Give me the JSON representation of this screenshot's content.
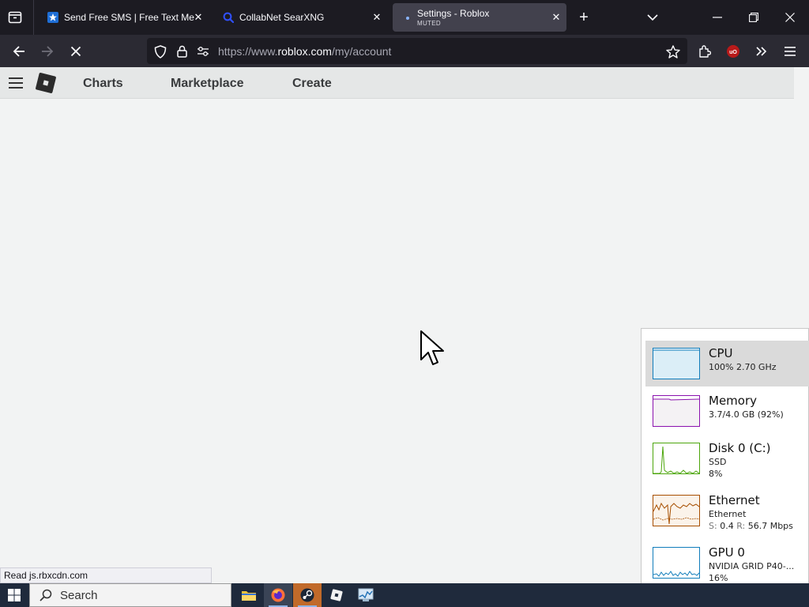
{
  "browser": {
    "tabs": [
      {
        "title": "Send Free SMS | Free Text Messages",
        "active": false,
        "icon": "textfree-favicon"
      },
      {
        "title": "CollabNet SearXNG",
        "active": false,
        "icon": "searxng-favicon"
      },
      {
        "title": "Settings - Roblox",
        "subtitle": "MUTED",
        "active": true,
        "icon": "loading-dot"
      }
    ],
    "url_prefix": "https://www.",
    "url_host": "roblox.com",
    "url_path": "/my/account",
    "status_text": "Read js.rbxcdn.com"
  },
  "roblox": {
    "nav": {
      "charts": "Charts",
      "marketplace": "Marketplace",
      "create": "Create"
    }
  },
  "task_manager": {
    "rows": [
      {
        "name": "CPU",
        "line1": "100%  2.70 GHz",
        "color": "#117dbb",
        "selected": true
      },
      {
        "name": "Memory",
        "line1": "3.7/4.0 GB (92%)",
        "color": "#8b12ae"
      },
      {
        "name": "Disk 0 (C:)",
        "line1": "SSD",
        "line2": "8%",
        "color": "#4da60c"
      },
      {
        "name": "Ethernet",
        "line1": "Ethernet",
        "line2_s_label": "S:",
        "line2_s": "0.4",
        "line2_r_label": "R:",
        "line2_r": "56.7 Mbps",
        "color": "#a74f01"
      },
      {
        "name": "GPU 0",
        "line1": "NVIDIA GRID P40-...",
        "line2": "16%",
        "color": "#117dbb"
      }
    ]
  },
  "taskbar": {
    "search_label": "Search",
    "apps": [
      "file-explorer-icon",
      "firefox-icon",
      "steam-icon",
      "roblox-player-icon",
      "task-manager-icon"
    ]
  },
  "colors": {
    "tab_strip": "#1c1b22",
    "nav_bar": "#2b2a33",
    "active_tab": "#42414d",
    "roblox_bg": "#f2f3f3",
    "taskbar": "#1f2a3c"
  }
}
